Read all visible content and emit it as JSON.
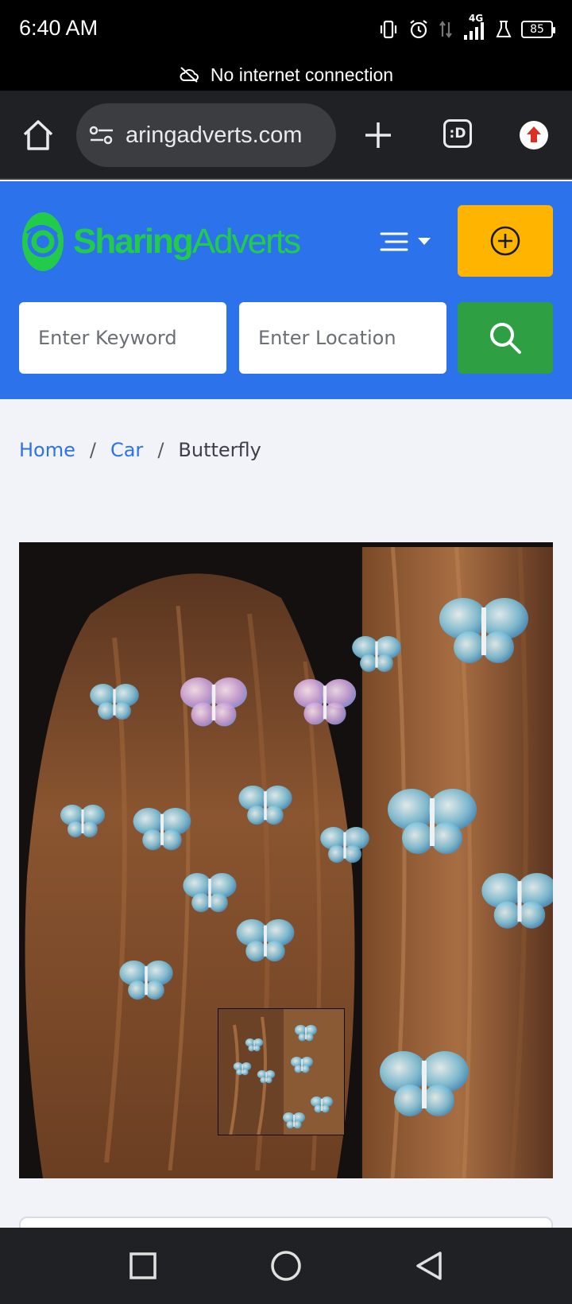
{
  "status_bar": {
    "time": "6:40 AM",
    "network": "4G",
    "battery": "85",
    "icons": [
      "vibrate-icon",
      "alarm-icon",
      "data-arrows-icon",
      "signal-icon",
      "flask-icon",
      "battery-icon"
    ]
  },
  "offline_banner": {
    "icon": "cloud-off-icon",
    "text": "No internet connection"
  },
  "browser": {
    "url": "aringadverts.com",
    "tab_switcher_label": ":D",
    "icons": [
      "home-icon",
      "site-settings-icon",
      "plus-icon",
      "tab-switcher-icon",
      "update-arrow-icon"
    ]
  },
  "header": {
    "logo_bold": "Sharing",
    "logo_light": "Adverts",
    "brand_color": "#2c73eb",
    "logo_color": "#22cc4a",
    "post_button_color": "#ffb400",
    "search_button_color": "#2ea043"
  },
  "search": {
    "keyword_placeholder": "Enter Keyword",
    "location_placeholder": "Enter Location"
  },
  "breadcrumb": {
    "home": "Home",
    "category": "Car",
    "current": "Butterfly",
    "separator": "/"
  },
  "nav": {
    "icons": [
      "recents-icon",
      "home-circle-icon",
      "back-icon"
    ]
  }
}
